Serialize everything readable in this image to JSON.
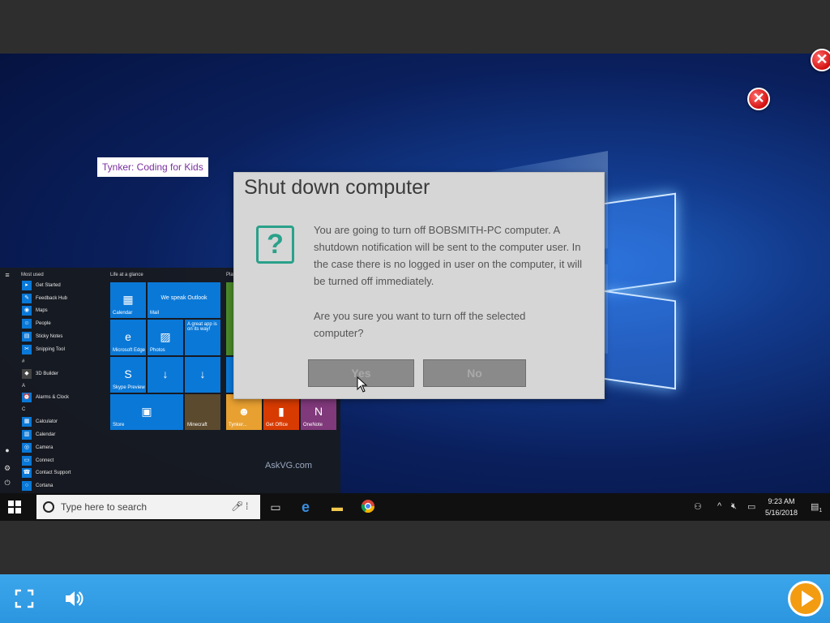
{
  "tooltip": {
    "text": "Tynker: Coding for Kids"
  },
  "dialog": {
    "title": "Shut down computer",
    "message": "You are going to turn off BOBSMITH-PC computer. A shutdown notification will be sent to the computer user. In the case there is no logged in user on the computer, it will be turned off immediately.",
    "question": "Are you sure you want to turn off the selected computer?",
    "yes_label": "Yes",
    "no_label": "No",
    "icon": "question-icon"
  },
  "start_menu": {
    "most_used_header": "Most used",
    "most_used": [
      "Get Started",
      "Feedback Hub",
      "Maps",
      "People",
      "Sticky Notes",
      "Snipping Tool"
    ],
    "hash_letter": "#",
    "hash_items": [
      "3D Builder"
    ],
    "a_letter": "A",
    "a_items": [
      "Alarms & Clock"
    ],
    "c_letter": "C",
    "c_items": [
      "Calculator",
      "Calendar",
      "Camera",
      "Connect",
      "Contact Support",
      "Cortana"
    ],
    "group1_title": "Life at a glance",
    "group2_title": "Play",
    "tiles": {
      "calendar": "Calendar",
      "mail": "Mail",
      "mail_caption": "We speak Outlook",
      "edge": "Microsoft Edge",
      "photos": "Photos",
      "great_app": "A great app is on its way!",
      "skype": "Skype Preview",
      "store": "Store",
      "minecraft": "Minecraft",
      "tynker": "Tynker...",
      "office": "Get Office",
      "onenote": "OneNote"
    }
  },
  "watermark": "AskVG.com",
  "taskbar": {
    "search_placeholder": "Type here to search",
    "time": "9:23 AM",
    "date": "5/16/2018",
    "notification_count": "1"
  },
  "colors": {
    "accent": "#0a78d7",
    "dialog_accent": "#2aa18a",
    "player_bar": "#3ca6ec",
    "play_button": "#f39c12",
    "close_red": "#d40f0f"
  }
}
